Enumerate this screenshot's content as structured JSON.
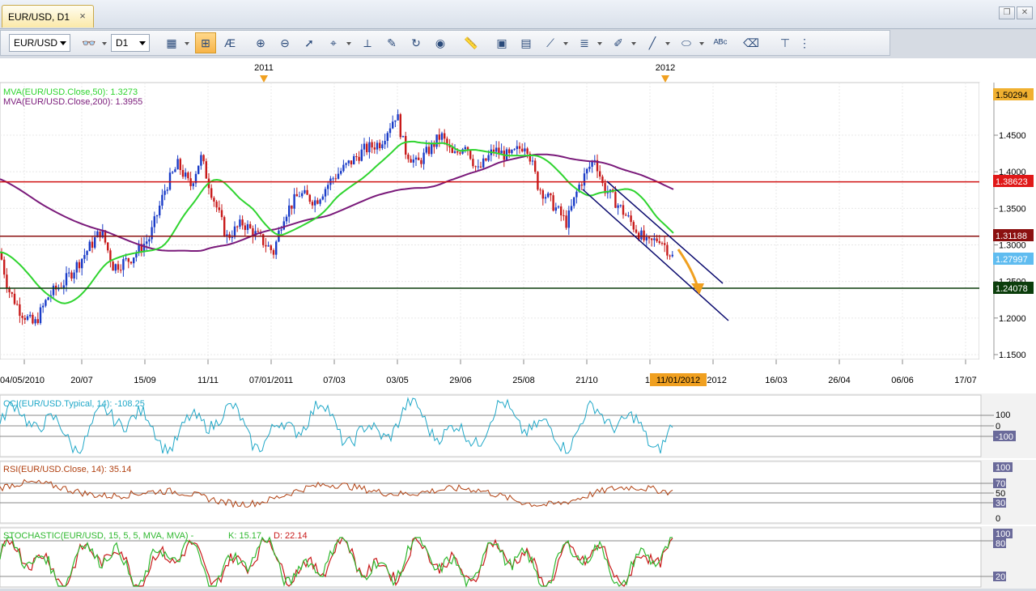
{
  "tab": {
    "title": "EUR/USD, D1"
  },
  "toolbar": {
    "symbol": "EUR/USD",
    "timeframe": "D1",
    "buttons": [
      "chart-type-icon",
      "bar-chart-icon",
      "text-icon",
      "zoom-in-icon",
      "zoom-out-icon",
      "cursor-icon",
      "crosshair-icon",
      "vertical-line-icon",
      "edit-icon",
      "redo-icon",
      "globe-icon",
      "ruler-icon",
      "picture-icon",
      "window-icon",
      "line-tools-icon",
      "fib-icon",
      "pencil-icon",
      "trend-line-icon",
      "ellipse-icon",
      "text-label-icon",
      "eraser-icon",
      "hierarchy-icon"
    ]
  },
  "chart": {
    "year_labels": [
      "2011",
      "2012"
    ],
    "ma50_label": "MVA(EUR/USD.Close,50): 1.3273",
    "ma200_label": "MVA(EUR/USD.Close,200): 1.3955",
    "price_ticks": [
      "1.4500",
      "1.4000",
      "1.3500",
      "1.3000",
      "1.2500",
      "1.2000",
      "1.1500"
    ],
    "price_tags": {
      "top": "1.50294",
      "resistance": "1.38623",
      "middle": "1.31188",
      "current": "1.27997",
      "support": "1.24078"
    },
    "date_labels": [
      "04/05/2010",
      "20/07",
      "15/09",
      "11/11",
      "07/01/2011",
      "07/03",
      "03/05",
      "29/06",
      "25/08",
      "21/10",
      "19",
      "2/2012",
      "16/03",
      "26/04",
      "06/06",
      "17/07"
    ],
    "cursor_date": "11/01/2012",
    "colors": {
      "ma50": "#2fd42f",
      "ma200": "#7a1a7a",
      "resistance": "#d01010",
      "middle": "#8b1010",
      "support": "#0b3d0b",
      "channel": "#0a0a6e",
      "arrow": "#f0a020",
      "up": "#1a3cc8",
      "down": "#c81a1a"
    }
  },
  "cci": {
    "label": "CCI(EUR/USD.Typical, 14): -108.25",
    "levels": [
      "100",
      "0",
      "-100"
    ]
  },
  "rsi": {
    "label": "RSI(EUR/USD.Close, 14): 35.14",
    "levels": [
      "100",
      "70",
      "50",
      "30",
      "0"
    ]
  },
  "stoch": {
    "label": "STOCHASTIC(EUR/USD, 15, 5, 5, MVA, MVA) -",
    "k": "K: 15.17",
    "d": "D: 22.14",
    "levels": [
      "100",
      "80",
      "20"
    ]
  }
}
